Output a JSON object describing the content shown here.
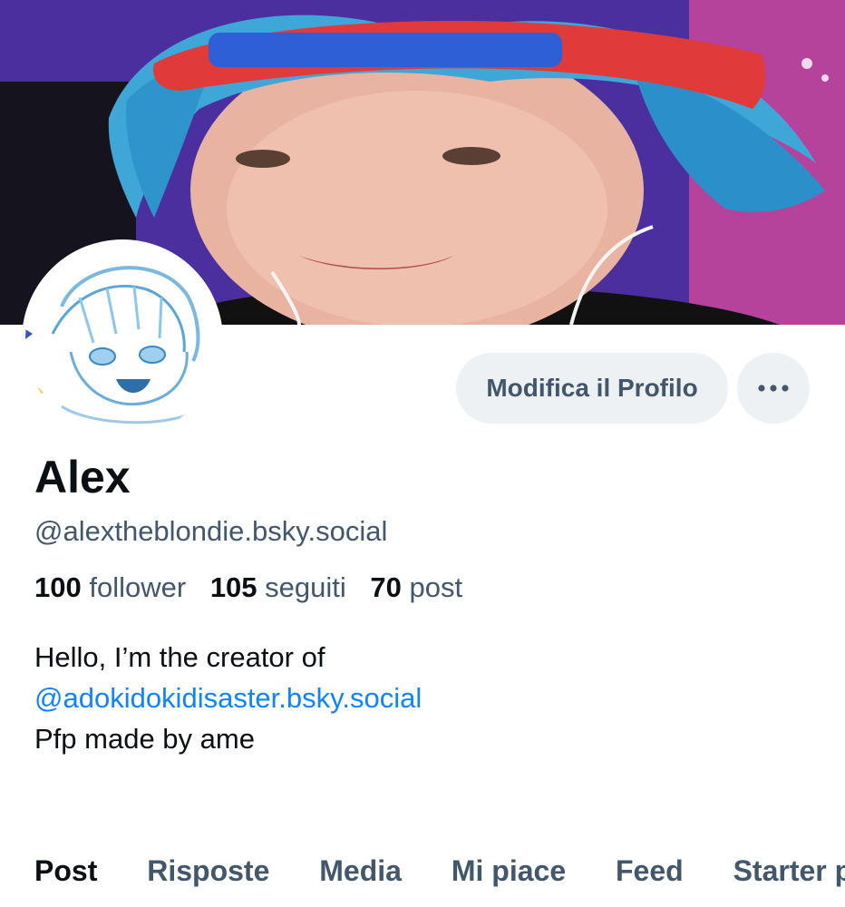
{
  "profile": {
    "display_name": "Alex",
    "handle": "@alextheblondie.bsky.social",
    "stats": {
      "followers_count": "100",
      "followers_label": "follower",
      "following_count": "105",
      "following_label": "seguiti",
      "posts_count": "70",
      "posts_label": "post"
    },
    "bio": {
      "line1": "Hello, I’m the creator of",
      "mention": "@adokidokidisaster.bsky.social",
      "line3": "Pfp made by ame"
    }
  },
  "actions": {
    "edit_label": "Modifica il Profilo",
    "more_label": "···"
  },
  "tabs": [
    {
      "label": "Post",
      "active": true
    },
    {
      "label": "Risposte"
    },
    {
      "label": "Media"
    },
    {
      "label": "Mi piace"
    },
    {
      "label": "Feed"
    },
    {
      "label": "Starter p"
    }
  ],
  "colors": {
    "accent": "#1083fe",
    "muted_text": "#42576c",
    "button_bg": "#eef1f4"
  }
}
